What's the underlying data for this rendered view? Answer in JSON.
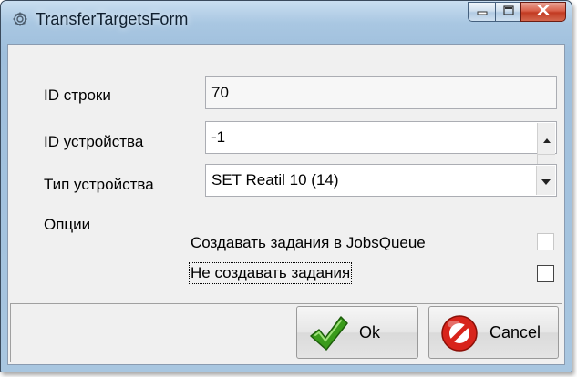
{
  "window": {
    "title": "TransferTargetsForm"
  },
  "form": {
    "row_id": {
      "label": "ID строки",
      "value": "70"
    },
    "device_id": {
      "label": "ID устройства",
      "value": "-1"
    },
    "device_type": {
      "label": "Тип устройства",
      "value": "SET Reatil 10 (14)"
    },
    "options": {
      "label": "Опции",
      "create_jobs": {
        "label": "Создавать задания в JobsQueue",
        "checked": false
      },
      "no_create_jobs": {
        "label": "Не создавать задания",
        "checked": false
      }
    }
  },
  "buttons": {
    "ok_label": "Ok",
    "cancel_label": "Cancel"
  },
  "icons": {
    "app": "gear-icon",
    "minimize": "minimize-icon",
    "maximize": "maximize-icon",
    "close": "close-icon",
    "ok": "check-icon",
    "cancel": "no-entry-icon"
  },
  "colors": {
    "title_bar": "#a9c7e2",
    "close_button": "#c23a22",
    "ok_icon": "#3a9b1b",
    "cancel_icon": "#d8241b"
  }
}
